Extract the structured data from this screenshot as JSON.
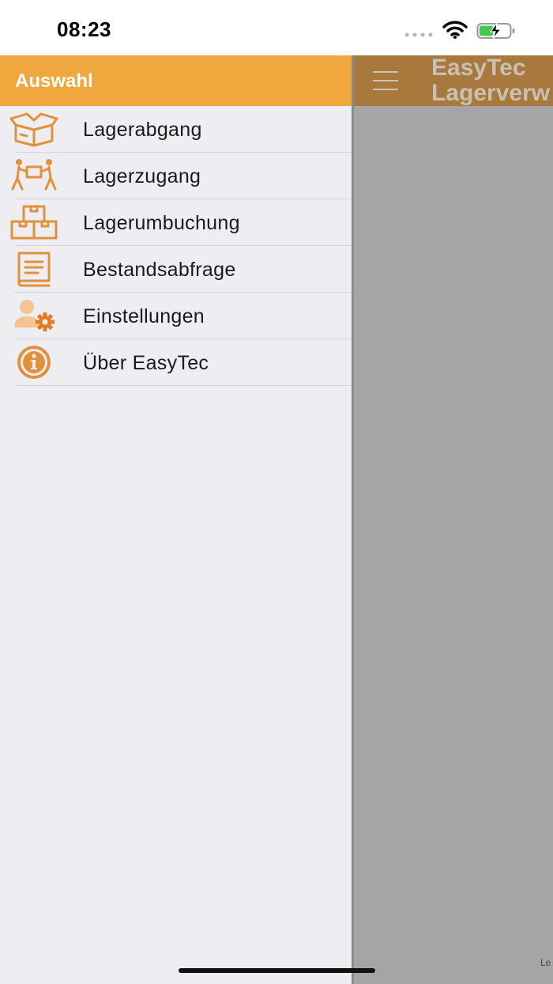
{
  "status_bar": {
    "time": "08:23",
    "icons": [
      "signal-dots-icon",
      "wifi-icon",
      "battery-charging-icon"
    ]
  },
  "sidebar": {
    "title": "Auswahl",
    "items": [
      {
        "label": "Lagerabgang",
        "icon": "open-box-icon"
      },
      {
        "label": "Lagerzugang",
        "icon": "people-carrying-box-icon"
      },
      {
        "label": "Lagerumbuchung",
        "icon": "stacked-boxes-icon"
      },
      {
        "label": "Bestandsabfrage",
        "icon": "book-icon"
      },
      {
        "label": "Einstellungen",
        "icon": "user-settings-icon"
      },
      {
        "label": "Über EasyTec",
        "icon": "info-icon"
      }
    ]
  },
  "main": {
    "title": "EasyTec\nLagerverw",
    "footer": "Le"
  },
  "colors": {
    "accent": "#f0a73d",
    "icon": "#e0913a",
    "sidebar_bg": "#eeedf2",
    "overlay": "#a5a5a7"
  }
}
